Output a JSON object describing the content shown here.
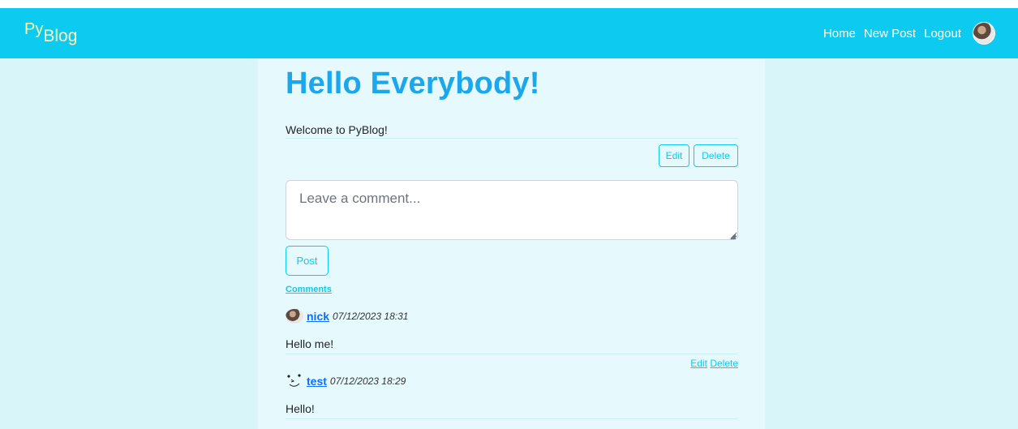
{
  "navbar": {
    "brand_py": "Py",
    "brand_blog": "Blog",
    "links": {
      "home": "Home",
      "new_post": "New Post",
      "logout": "Logout"
    }
  },
  "post": {
    "title": "Hello Everybody!",
    "body": "Welcome to PyBlog!",
    "edit_label": "Edit",
    "delete_label": "Delete"
  },
  "comment_form": {
    "placeholder": "Leave a comment...",
    "submit_label": "Post"
  },
  "comments_heading": "Comments",
  "comments": [
    {
      "author": "nick",
      "date": "07/12/2023 18:31",
      "text": "Hello me!",
      "edit_label": "Edit",
      "delete_label": "Delete",
      "avatar": "photo-avatar"
    },
    {
      "author": "test",
      "date": "07/12/2023 18:29",
      "text": "Hello!",
      "avatar": "smiley-avatar"
    }
  ],
  "colors": {
    "navbar": "#0dcaf0",
    "title": "#1aa7ec",
    "page_bg": "#d8f6fa",
    "container_bg": "#e6f9fc",
    "link": "#0d6efd"
  }
}
